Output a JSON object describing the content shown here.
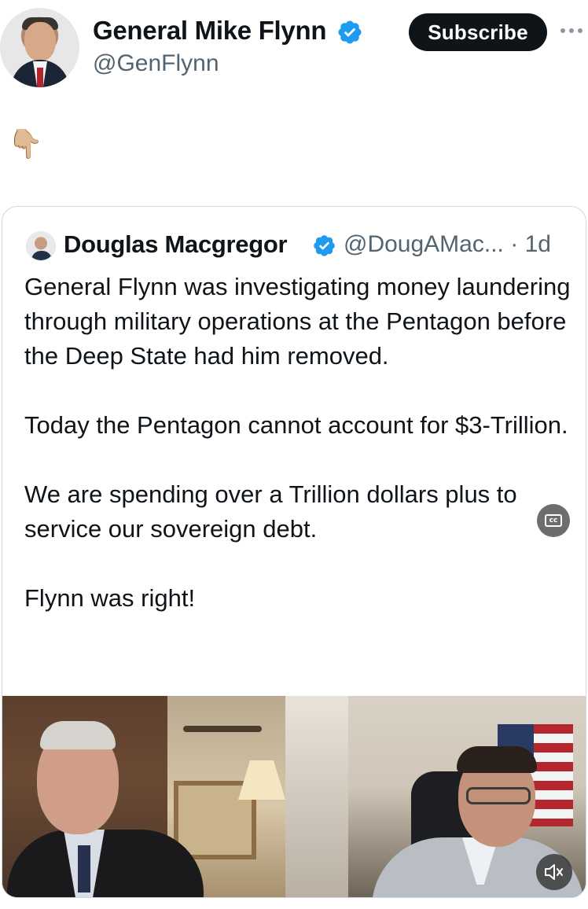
{
  "author": {
    "name": "General Mike Flynn",
    "handle": "@GenFlynn",
    "avatar_icon": "profile-photo",
    "verified_icon": "verified-badge-icon"
  },
  "actions": {
    "subscribe_label": "Subscribe",
    "more_icon": "more-horizontal-icon"
  },
  "post": {
    "emoji": "👇🏼"
  },
  "quote": {
    "author_name": "Douglas Macgregor",
    "handle": "@DougAMac...",
    "separator": "·",
    "time": "1d",
    "paragraphs": [
      "General Flynn was investigating money laundering through military operations at the Pentagon before the Deep State had him removed.",
      "Today the Pentagon cannot account for $3-Trillion.",
      "We are spending over a Trillion dollars plus to service our sovereign debt.",
      "Flynn was right!"
    ]
  },
  "media": {
    "type": "video",
    "captions_icon": "closed-captions-icon",
    "mute_icon": "speaker-muted-icon"
  },
  "colors": {
    "text_primary": "#0f1419",
    "text_secondary": "#536471",
    "verified_blue": "#1d9bf0",
    "button_bg": "#0f1419",
    "card_border": "#cfd9de"
  }
}
